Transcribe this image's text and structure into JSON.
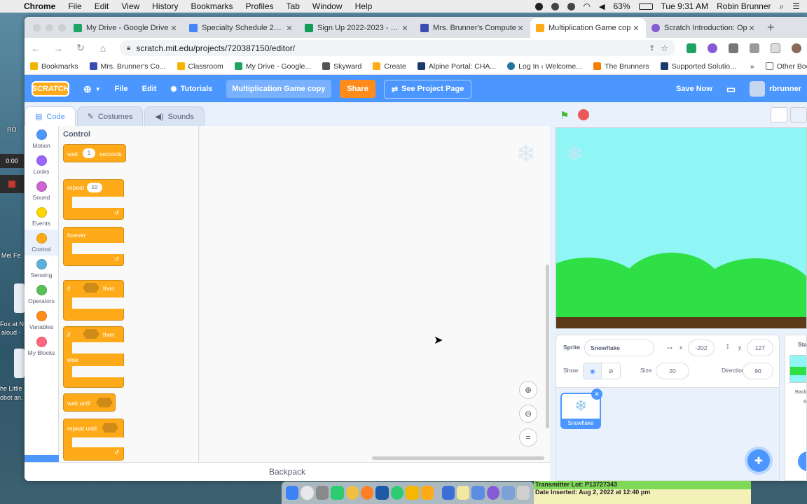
{
  "menubar": {
    "app": "Chrome",
    "items": [
      "File",
      "Edit",
      "View",
      "History",
      "Bookmarks",
      "Profiles",
      "Tab",
      "Window",
      "Help"
    ],
    "battery": "63%",
    "clock": "Tue 9:31 AM",
    "user": "Robin Brunner"
  },
  "desktop": {
    "frag1": "RO",
    "frag2": "Mel Fe",
    "frag3": "Fox at N",
    "frag4": "aloud -",
    "frag5": "he Little",
    "frag6": "obot an.",
    "recording_time": "0:00"
  },
  "browser": {
    "tabs": [
      {
        "title": "My Drive - Google Drive",
        "color": "#1fa463"
      },
      {
        "title": "Specialty Schedule 2022",
        "color": "#4285f4"
      },
      {
        "title": "Sign Up 2022-2023 - Go",
        "color": "#0f9d58"
      },
      {
        "title": "Mrs. Brunner's Compute",
        "color": "#3c4bb0"
      },
      {
        "title": "Multiplication Game cop",
        "color": "#ffab19"
      },
      {
        "title": "Scratch Introduction: Op",
        "color": "#855cd6"
      }
    ],
    "url": "scratch.mit.edu/projects/720387150/editor/",
    "bookmarks": [
      {
        "label": "Bookmarks",
        "color": "#f4b400"
      },
      {
        "label": "Mrs. Brunner's Co...",
        "color": "#3c4bb0"
      },
      {
        "label": "Classroom",
        "color": "#f4b400"
      },
      {
        "label": "My Drive - Google...",
        "color": "#1fa463"
      },
      {
        "label": "Skyward",
        "color": "#555555"
      },
      {
        "label": "Create",
        "color": "#ffab19"
      },
      {
        "label": "Alpine Portal: CHA...",
        "color": "#1b3a6b"
      },
      {
        "label": "Log In ‹ Welcome...",
        "color": "#21759b"
      },
      {
        "label": "The Brunners",
        "color": "#f57d00"
      },
      {
        "label": "Supported Solutio...",
        "color": "#1b3a6b"
      }
    ],
    "other_bookmarks": "Other Bookm"
  },
  "scratch": {
    "logo": "SCRATCH",
    "file": "File",
    "edit": "Edit",
    "tutorials": "Tutorials",
    "project_title": "Multiplication  Game copy",
    "share": "Share",
    "see_project": "See Project Page",
    "save_now": "Save Now",
    "username": "rbrunner"
  },
  "editor": {
    "tabs": {
      "code": "Code",
      "costumes": "Costumes",
      "sounds": "Sounds"
    },
    "categories": [
      {
        "label": "Motion",
        "color": "#4c97ff"
      },
      {
        "label": "Looks",
        "color": "#9966ff"
      },
      {
        "label": "Sound",
        "color": "#cf63cf"
      },
      {
        "label": "Events",
        "color": "#ffd500"
      },
      {
        "label": "Control",
        "color": "#ffab19"
      },
      {
        "label": "Sensing",
        "color": "#5cb1d6"
      },
      {
        "label": "Operators",
        "color": "#59c059"
      },
      {
        "label": "Variables",
        "color": "#ff8c1a"
      },
      {
        "label": "My Blocks",
        "color": "#ff6680"
      }
    ],
    "palette_heading": "Control",
    "blocks": {
      "wait": "wait",
      "wait_value": "1",
      "seconds": "seconds",
      "repeat": "repeat",
      "repeat_value": "10",
      "forever": "forever",
      "if1": "if",
      "then1": "then",
      "if2": "if",
      "then2": "then",
      "else": "else",
      "wait_until": "wait until",
      "repeat_until": "repeat until"
    },
    "backpack": "Backpack"
  },
  "stage": {
    "sprite_label": "Sprite",
    "sprite_name": "Snowflake",
    "x_label": "x",
    "x_value": "-202",
    "y_label": "y",
    "y_value": "127",
    "show_label": "Show",
    "size_label": "Size",
    "size_value": "20",
    "direction_label": "Direction",
    "direction_value": "90",
    "thumb_name": "Snowflake",
    "stage_tab": "Stag",
    "backdrop_label": "Backd",
    "backdrop_count": "6"
  },
  "bottom_label": {
    "line1": "Transmitter Lot: P13727343",
    "line2": "Date Inserted: Aug 2, 2022 at 12:40 pm"
  },
  "colors": {
    "scratch_blue": "#4c97ff",
    "control_orange": "#ffab19",
    "stage_sky": "#8ff5f5",
    "hills": "#2ee045",
    "dirt": "#5b3a1a"
  }
}
